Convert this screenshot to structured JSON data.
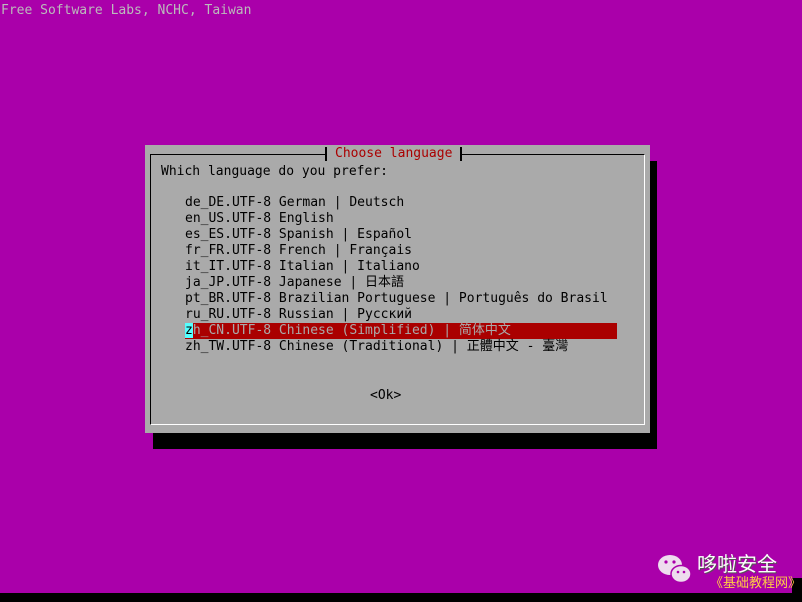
{
  "banner": "Free Software Labs, NCHC, Taiwan",
  "dialog": {
    "title": "Choose language",
    "prompt": "Which language do you prefer:",
    "items": [
      "de_DE.UTF-8 German | Deutsch",
      "en_US.UTF-8 English",
      "es_ES.UTF-8 Spanish | Español",
      "fr_FR.UTF-8 French | Français",
      "it_IT.UTF-8 Italian | Italiano",
      "ja_JP.UTF-8 Japanese | 日本語",
      "pt_BR.UTF-8 Brazilian Portuguese | Português do Brasil",
      "ru_RU.UTF-8 Russian | Русский",
      "zh_CN.UTF-8 Chinese (Simplified) | 简体中文",
      "zh_TW.UTF-8 Chinese (Traditional) | 正體中文 - 臺灣"
    ],
    "selected_index": 8,
    "selected_first": "z",
    "selected_rest": "h_CN.UTF-8 Chinese (Simplified) | 简体中文",
    "ok_label": "<Ok>"
  },
  "watermark": {
    "name": "哆啦安全",
    "sub": "《基础教程网》"
  },
  "colors": {
    "background": "#aa00aa",
    "dialog": "#aaaaaa",
    "highlight": "#aa0000",
    "cursor": "#55ffff"
  }
}
